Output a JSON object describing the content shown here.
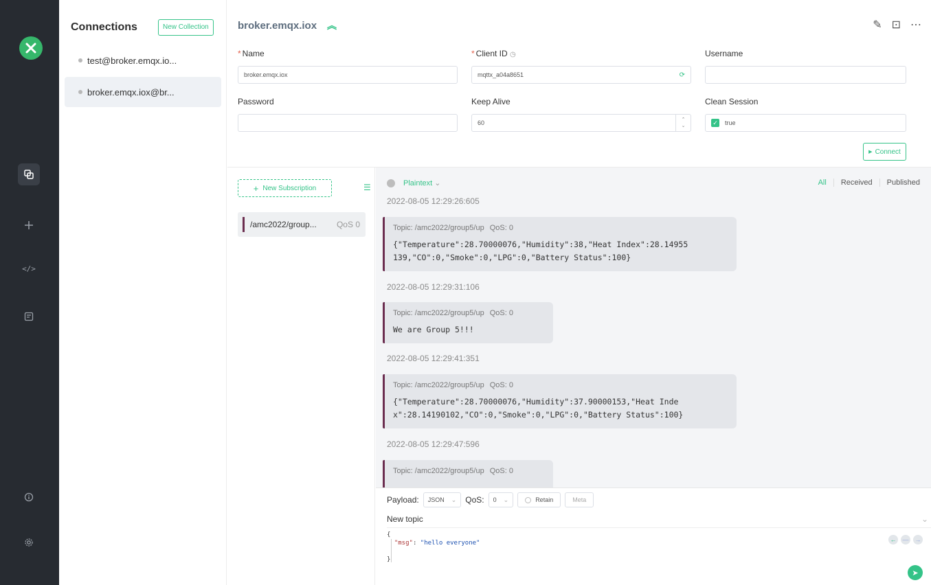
{
  "rail": {
    "logo_icon": "mqttx-logo",
    "items": [
      {
        "name": "connections-icon",
        "glyph": "⧉"
      },
      {
        "name": "plus-icon",
        "glyph": "+"
      },
      {
        "name": "script-icon",
        "glyph": "</>"
      },
      {
        "name": "log-icon",
        "glyph": "▤"
      }
    ],
    "bottom": [
      {
        "name": "info-icon",
        "glyph": "ⓘ"
      },
      {
        "name": "settings-icon",
        "glyph": "⚙"
      }
    ]
  },
  "connections": {
    "title": "Connections",
    "new_collection": "New Collection",
    "items": [
      {
        "label": "test@broker.emqx.io..."
      },
      {
        "label": "broker.emqx.iox@br..."
      }
    ]
  },
  "header": {
    "title": "broker.emqx.iox",
    "collapse_icon": "double-chevron-up-icon",
    "icons": [
      "edit-icon",
      "new-window-icon",
      "more-icon"
    ]
  },
  "form": {
    "name_label": "Name",
    "name_value": "broker.emqx.iox",
    "client_id_label": "Client ID",
    "client_id_value": "mqttx_a04a8651",
    "username_label": "Username",
    "username_value": "",
    "password_label": "Password",
    "password_value": "",
    "keep_alive_label": "Keep Alive",
    "keep_alive_value": "60",
    "clean_session_label": "Clean Session",
    "clean_session_value": "true",
    "connect_label": "Connect"
  },
  "subscriptions": {
    "new_label": "New Subscription",
    "items": [
      {
        "topic": "/amc2022/group...",
        "qos": "QoS 0",
        "color": "#6b2d4f"
      }
    ]
  },
  "messages": {
    "format": "Plaintext",
    "filters": [
      "All",
      "Received",
      "Published"
    ],
    "list": [
      {
        "ts": "2022-08-05 12:29:26:605",
        "topic": "Topic: /amc2022/group5/up",
        "qos": "QoS: 0",
        "payload": "{\"Temperature\":28.70000076,\"Humidity\":38,\"Heat Index\":28.14955\n139,\"CO\":0,\"Smoke\":0,\"LPG\":0,\"Battery Status\":100}"
      },
      {
        "ts": "2022-08-05 12:29:31:106",
        "topic": "Topic: /amc2022/group5/up",
        "qos": "QoS: 0",
        "payload": "We are Group 5!!!"
      },
      {
        "ts": "2022-08-05 12:29:41:351",
        "topic": "Topic: /amc2022/group5/up",
        "qos": "QoS: 0",
        "payload": "{\"Temperature\":28.70000076,\"Humidity\":37.90000153,\"Heat Inde\nx\":28.14190102,\"CO\":0,\"Smoke\":0,\"LPG\":0,\"Battery Status\":100}"
      },
      {
        "ts": "2022-08-05 12:29:47:596",
        "topic": "Topic: /amc2022/group5/up",
        "qos": "QoS: 0",
        "payload": ""
      }
    ]
  },
  "publish": {
    "payload_label": "Payload:",
    "payload_format": "JSON",
    "qos_label": "QoS:",
    "qos_value": "0",
    "retain_label": "Retain",
    "meta_label": "Meta",
    "topic_placeholder": "New topic",
    "code_open": "{",
    "code_key": "\"msg\"",
    "code_value": "\"hello everyone\"",
    "code_close": "}"
  },
  "colors": {
    "accent": "#34c388",
    "rail": "#272b31",
    "topic_bar": "#6b2d4f"
  }
}
